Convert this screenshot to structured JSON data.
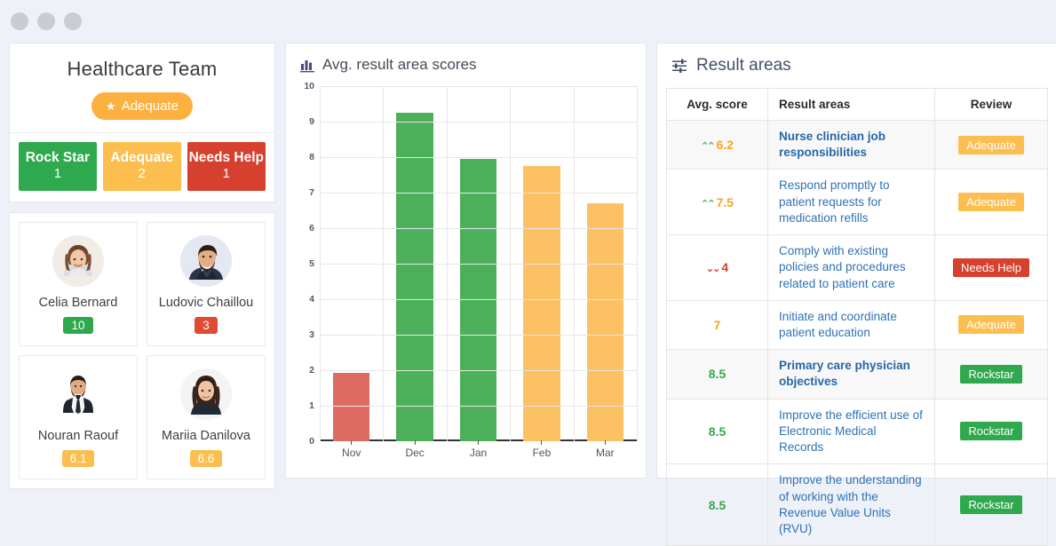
{
  "window": {
    "dots": 3
  },
  "left_panel": {
    "team_title": "Healthcare Team",
    "status_pill": {
      "icon": "star-icon",
      "label": "Adequate",
      "color": "#fbb03f"
    },
    "counters": [
      {
        "label": "Rock Star",
        "count": "1",
        "color": "#2ea94d"
      },
      {
        "label": "Adequate",
        "count": "2",
        "color": "#fcbe4f"
      },
      {
        "label": "Needs Help",
        "count": "1",
        "color": "#d6402f"
      }
    ],
    "people": [
      {
        "name": "Celia Bernard",
        "score": "10",
        "score_color": "#2ea94d",
        "avatar": "woman-brown-hair"
      },
      {
        "name": "Ludovic Chaillou",
        "score": "3",
        "score_color": "#e04b33",
        "avatar": "man-beard-suit"
      },
      {
        "name": "Nouran Raouf",
        "score": "6.1",
        "score_color": "#fcbe4f",
        "avatar": "man-suit-tie"
      },
      {
        "name": "Mariia Danilova",
        "score": "6.6",
        "score_color": "#fcbe4f",
        "avatar": "woman-dark-hair"
      }
    ]
  },
  "chart_panel": {
    "icon": "bar-chart-icon",
    "title": "Avg. result area scores"
  },
  "chart_data": {
    "type": "bar",
    "title": "Avg. result area scores",
    "categories": [
      "Nov",
      "Dec",
      "Jan",
      "Feb",
      "Mar"
    ],
    "values": [
      1.93,
      9.25,
      7.94,
      7.76,
      6.71
    ],
    "bar_colors": [
      "#dd6b62",
      "#4cb05a",
      "#4cb05a",
      "#fcc163",
      "#fcc163"
    ],
    "xlabel": "",
    "ylabel": "",
    "ylim": [
      0,
      10
    ],
    "yticks": [
      0,
      1,
      2,
      3,
      4,
      5,
      6,
      7,
      8,
      9,
      10
    ],
    "grid": true,
    "legend": false
  },
  "result_areas": {
    "icon": "sliders-icon",
    "title": "Result areas",
    "columns": [
      "Avg. score",
      "Result areas",
      "Review"
    ],
    "rows": [
      {
        "trend": "up",
        "score": "6.2",
        "score_color": "#f5a623",
        "area": "Nurse clinician job responsibilities",
        "bold": true,
        "review": "Adequate",
        "review_color": "#fcbe4f",
        "striped": true
      },
      {
        "trend": "up",
        "score": "7.5",
        "score_color": "#f5a623",
        "area": "Respond promptly to patient requests for medication refills",
        "bold": false,
        "review": "Adequate",
        "review_color": "#fcbe4f",
        "striped": false
      },
      {
        "trend": "down",
        "score": "4",
        "score_color": "#d6402f",
        "area": "Comply with existing policies and procedures related to patient care",
        "bold": false,
        "review": "Needs Help",
        "review_color": "#d6402f",
        "striped": false
      },
      {
        "trend": "none",
        "score": "7",
        "score_color": "#f5a623",
        "area": "Initiate and coordinate patient education",
        "bold": false,
        "review": "Adequate",
        "review_color": "#fcbe4f",
        "striped": false
      },
      {
        "trend": "none",
        "score": "8.5",
        "score_color": "#39a552",
        "area": "Primary care physician objectives",
        "bold": true,
        "review": "Rockstar",
        "review_color": "#2ea94d",
        "striped": true
      },
      {
        "trend": "none",
        "score": "8.5",
        "score_color": "#39a552",
        "area": "Improve the efficient use of Electronic Medical Records",
        "bold": false,
        "review": "Rockstar",
        "review_color": "#2ea94d",
        "striped": false
      },
      {
        "trend": "none",
        "score": "8.5",
        "score_color": "#39a552",
        "area": "Improve the understanding of working with the Revenue Value Units (RVU)",
        "bold": false,
        "review": "Rockstar",
        "review_color": "#2ea94d",
        "striped": false
      }
    ]
  }
}
